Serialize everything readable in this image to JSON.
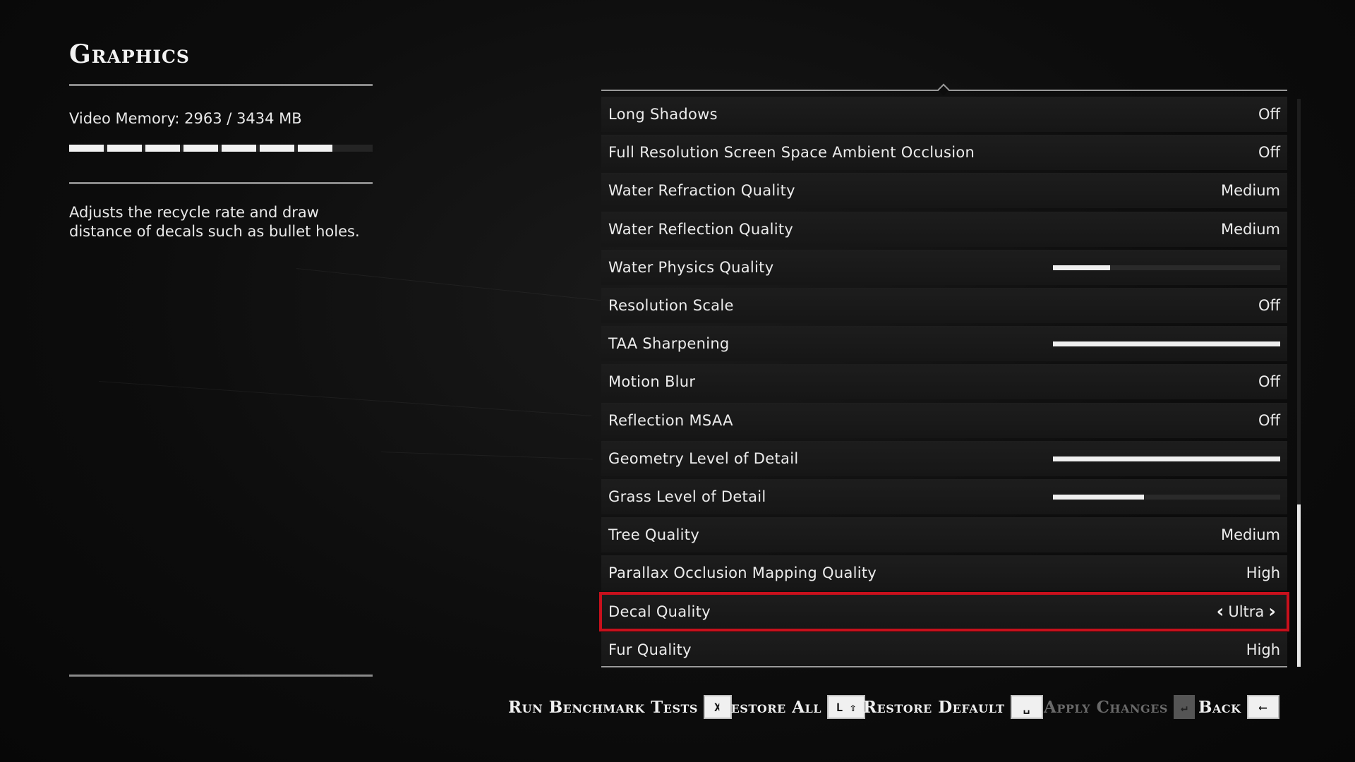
{
  "left_panel": {
    "title": "Graphics",
    "video_memory_label": "Video Memory:",
    "video_memory_used": "2963",
    "video_memory_sep": "/",
    "video_memory_total": "3434 MB",
    "video_memory_fraction": 0.863,
    "description": "Adjusts the recycle rate and draw distance of decals such as bullet holes."
  },
  "settings": [
    {
      "label": "Long Shadows",
      "value": "Off"
    },
    {
      "label": "Full Resolution Screen Space Ambient Occlusion",
      "value": "Off"
    },
    {
      "label": "Water Refraction Quality",
      "value": "Medium"
    },
    {
      "label": "Water Reflection Quality",
      "value": "Medium"
    },
    {
      "label": "Water Physics Quality",
      "slider": 0.25
    },
    {
      "label": "Resolution Scale",
      "value": "Off"
    },
    {
      "label": "TAA Sharpening",
      "slider": 1.0
    },
    {
      "label": "Motion Blur",
      "value": "Off"
    },
    {
      "label": "Reflection MSAA",
      "value": "Off"
    },
    {
      "label": "Geometry Level of Detail",
      "slider": 1.0
    },
    {
      "label": "Grass Level of Detail",
      "slider": 0.4
    },
    {
      "label": "Tree Quality",
      "value": "Medium"
    },
    {
      "label": "Parallax Occlusion Mapping Quality",
      "value": "High"
    },
    {
      "label": "Decal Quality",
      "value": "Ultra",
      "selected": true
    },
    {
      "label": "Fur Quality",
      "value": "High"
    }
  ],
  "actions": {
    "run_benchmark": {
      "label": "Run Benchmark Tests",
      "key": "X"
    },
    "restore_all": {
      "label": "Restore All",
      "key": "L ⇧"
    },
    "restore_default": {
      "label": "Restore Default",
      "key": "␣"
    },
    "apply_changes": {
      "label": "Apply Changes",
      "key": "↵",
      "disabled": true
    },
    "back": {
      "label": "Back",
      "key": "⟵"
    }
  },
  "icons": {
    "prev": "chevron-left-icon",
    "next": "chevron-right-icon"
  },
  "colors": {
    "selection": "#c8101c",
    "background": "#0b0b0b"
  }
}
